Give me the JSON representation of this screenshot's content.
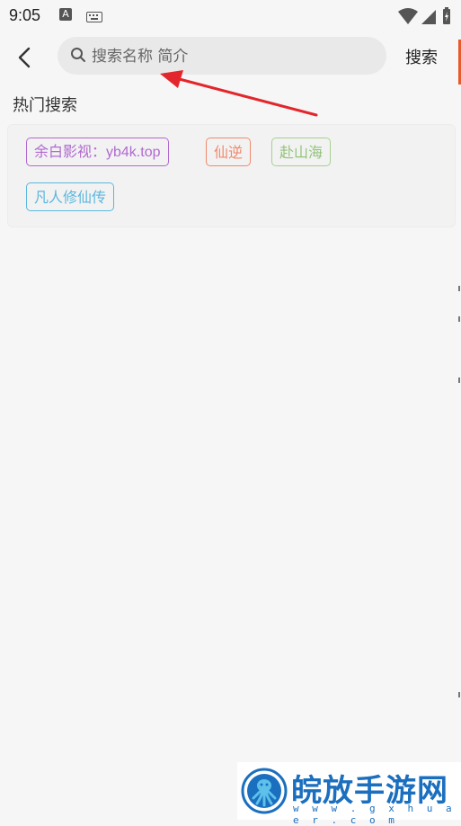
{
  "status_bar": {
    "time": "9:05",
    "notification_icon": "A"
  },
  "header": {
    "search_placeholder": "搜索名称 简介",
    "search_button": "搜索"
  },
  "hot_search": {
    "title": "热门搜索",
    "tags": [
      {
        "label": "余白影视：yb4k.top",
        "color": "#b06ad0"
      },
      {
        "label": "仙逆",
        "color": "#f08a6c"
      },
      {
        "label": "赴山海",
        "color": "#92c47a"
      },
      {
        "label": "凡人修仙传",
        "color": "#5bb7de"
      }
    ]
  },
  "watermark": {
    "title": "皖放手游网",
    "url": "w w w . g x h u a e r . c o m"
  },
  "colors": {
    "annotation_arrow": "#e3262b",
    "brand_blue": "#1b6fbf"
  }
}
